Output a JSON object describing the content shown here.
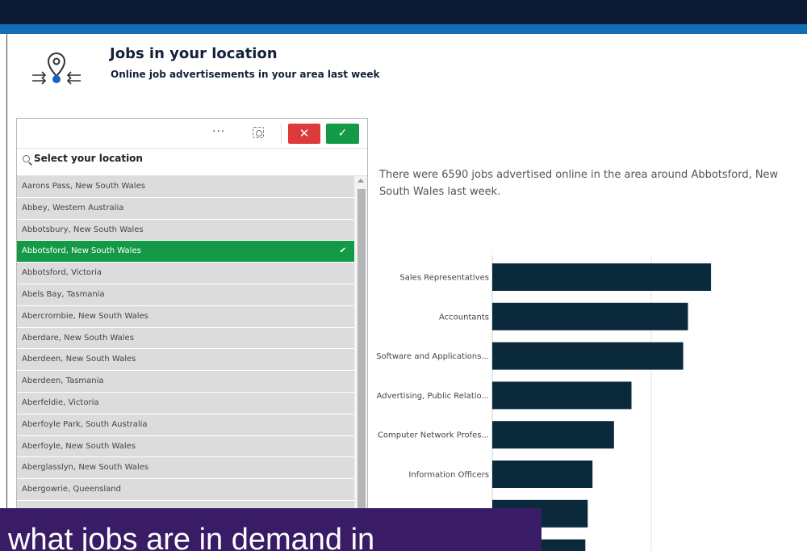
{
  "header": {
    "title": "Jobs in your location",
    "subtitle": "Online job advertisements in your area last week",
    "icon": "location-pin-arrows-icon"
  },
  "colors": {
    "top_bar": "#0c1a33",
    "accent_strip": "#0f6eb6",
    "selected": "#149a46",
    "cancel": "#dd3a3a",
    "bar": "#0a2a3c",
    "overlay": "#3a1c66"
  },
  "selector": {
    "toolbar": {
      "more_label": "···",
      "cancel_label": "✕",
      "confirm_label": "✓"
    },
    "search_label": "Select your location",
    "items": [
      {
        "label": "Aarons Pass, New South Wales",
        "selected": false
      },
      {
        "label": "Abbey, Western Australia",
        "selected": false
      },
      {
        "label": "Abbotsbury, New South Wales",
        "selected": false
      },
      {
        "label": "Abbotsford, New South Wales",
        "selected": true
      },
      {
        "label": "Abbotsford, Victoria",
        "selected": false
      },
      {
        "label": "Abels Bay, Tasmania",
        "selected": false
      },
      {
        "label": "Abercrombie, New South Wales",
        "selected": false
      },
      {
        "label": "Aberdare, New South Wales",
        "selected": false
      },
      {
        "label": "Aberdeen, New South Wales",
        "selected": false
      },
      {
        "label": "Aberdeen, Tasmania",
        "selected": false
      },
      {
        "label": "Aberfeldie, Victoria",
        "selected": false
      },
      {
        "label": "Aberfoyle Park, South Australia",
        "selected": false
      },
      {
        "label": "Aberfoyle, New South Wales",
        "selected": false
      },
      {
        "label": "Aberglasslyn, New South Wales",
        "selected": false
      },
      {
        "label": "Abergowrie, Queensland",
        "selected": false
      },
      {
        "label": "",
        "selected": false
      },
      {
        "label": "",
        "selected": false
      },
      {
        "label": "",
        "selected": false
      }
    ]
  },
  "info_text": "There were 6590 jobs advertised online in the area around Abbotsford, New South Wales last week.",
  "chart_data": {
    "type": "bar",
    "orientation": "horizontal",
    "categories": [
      "Sales Representatives",
      "Accountants",
      "Software and Applications...",
      "Advertising, Public Relatio...",
      "Computer Network Profes...",
      "Information Officers",
      "",
      ""
    ],
    "values": [
      275,
      246,
      240,
      175,
      153,
      126,
      120,
      117
    ],
    "xlim": [
      0,
      280
    ],
    "grid": true,
    "legend": "none"
  },
  "overlay": {
    "text": "what jobs are in demand in"
  }
}
